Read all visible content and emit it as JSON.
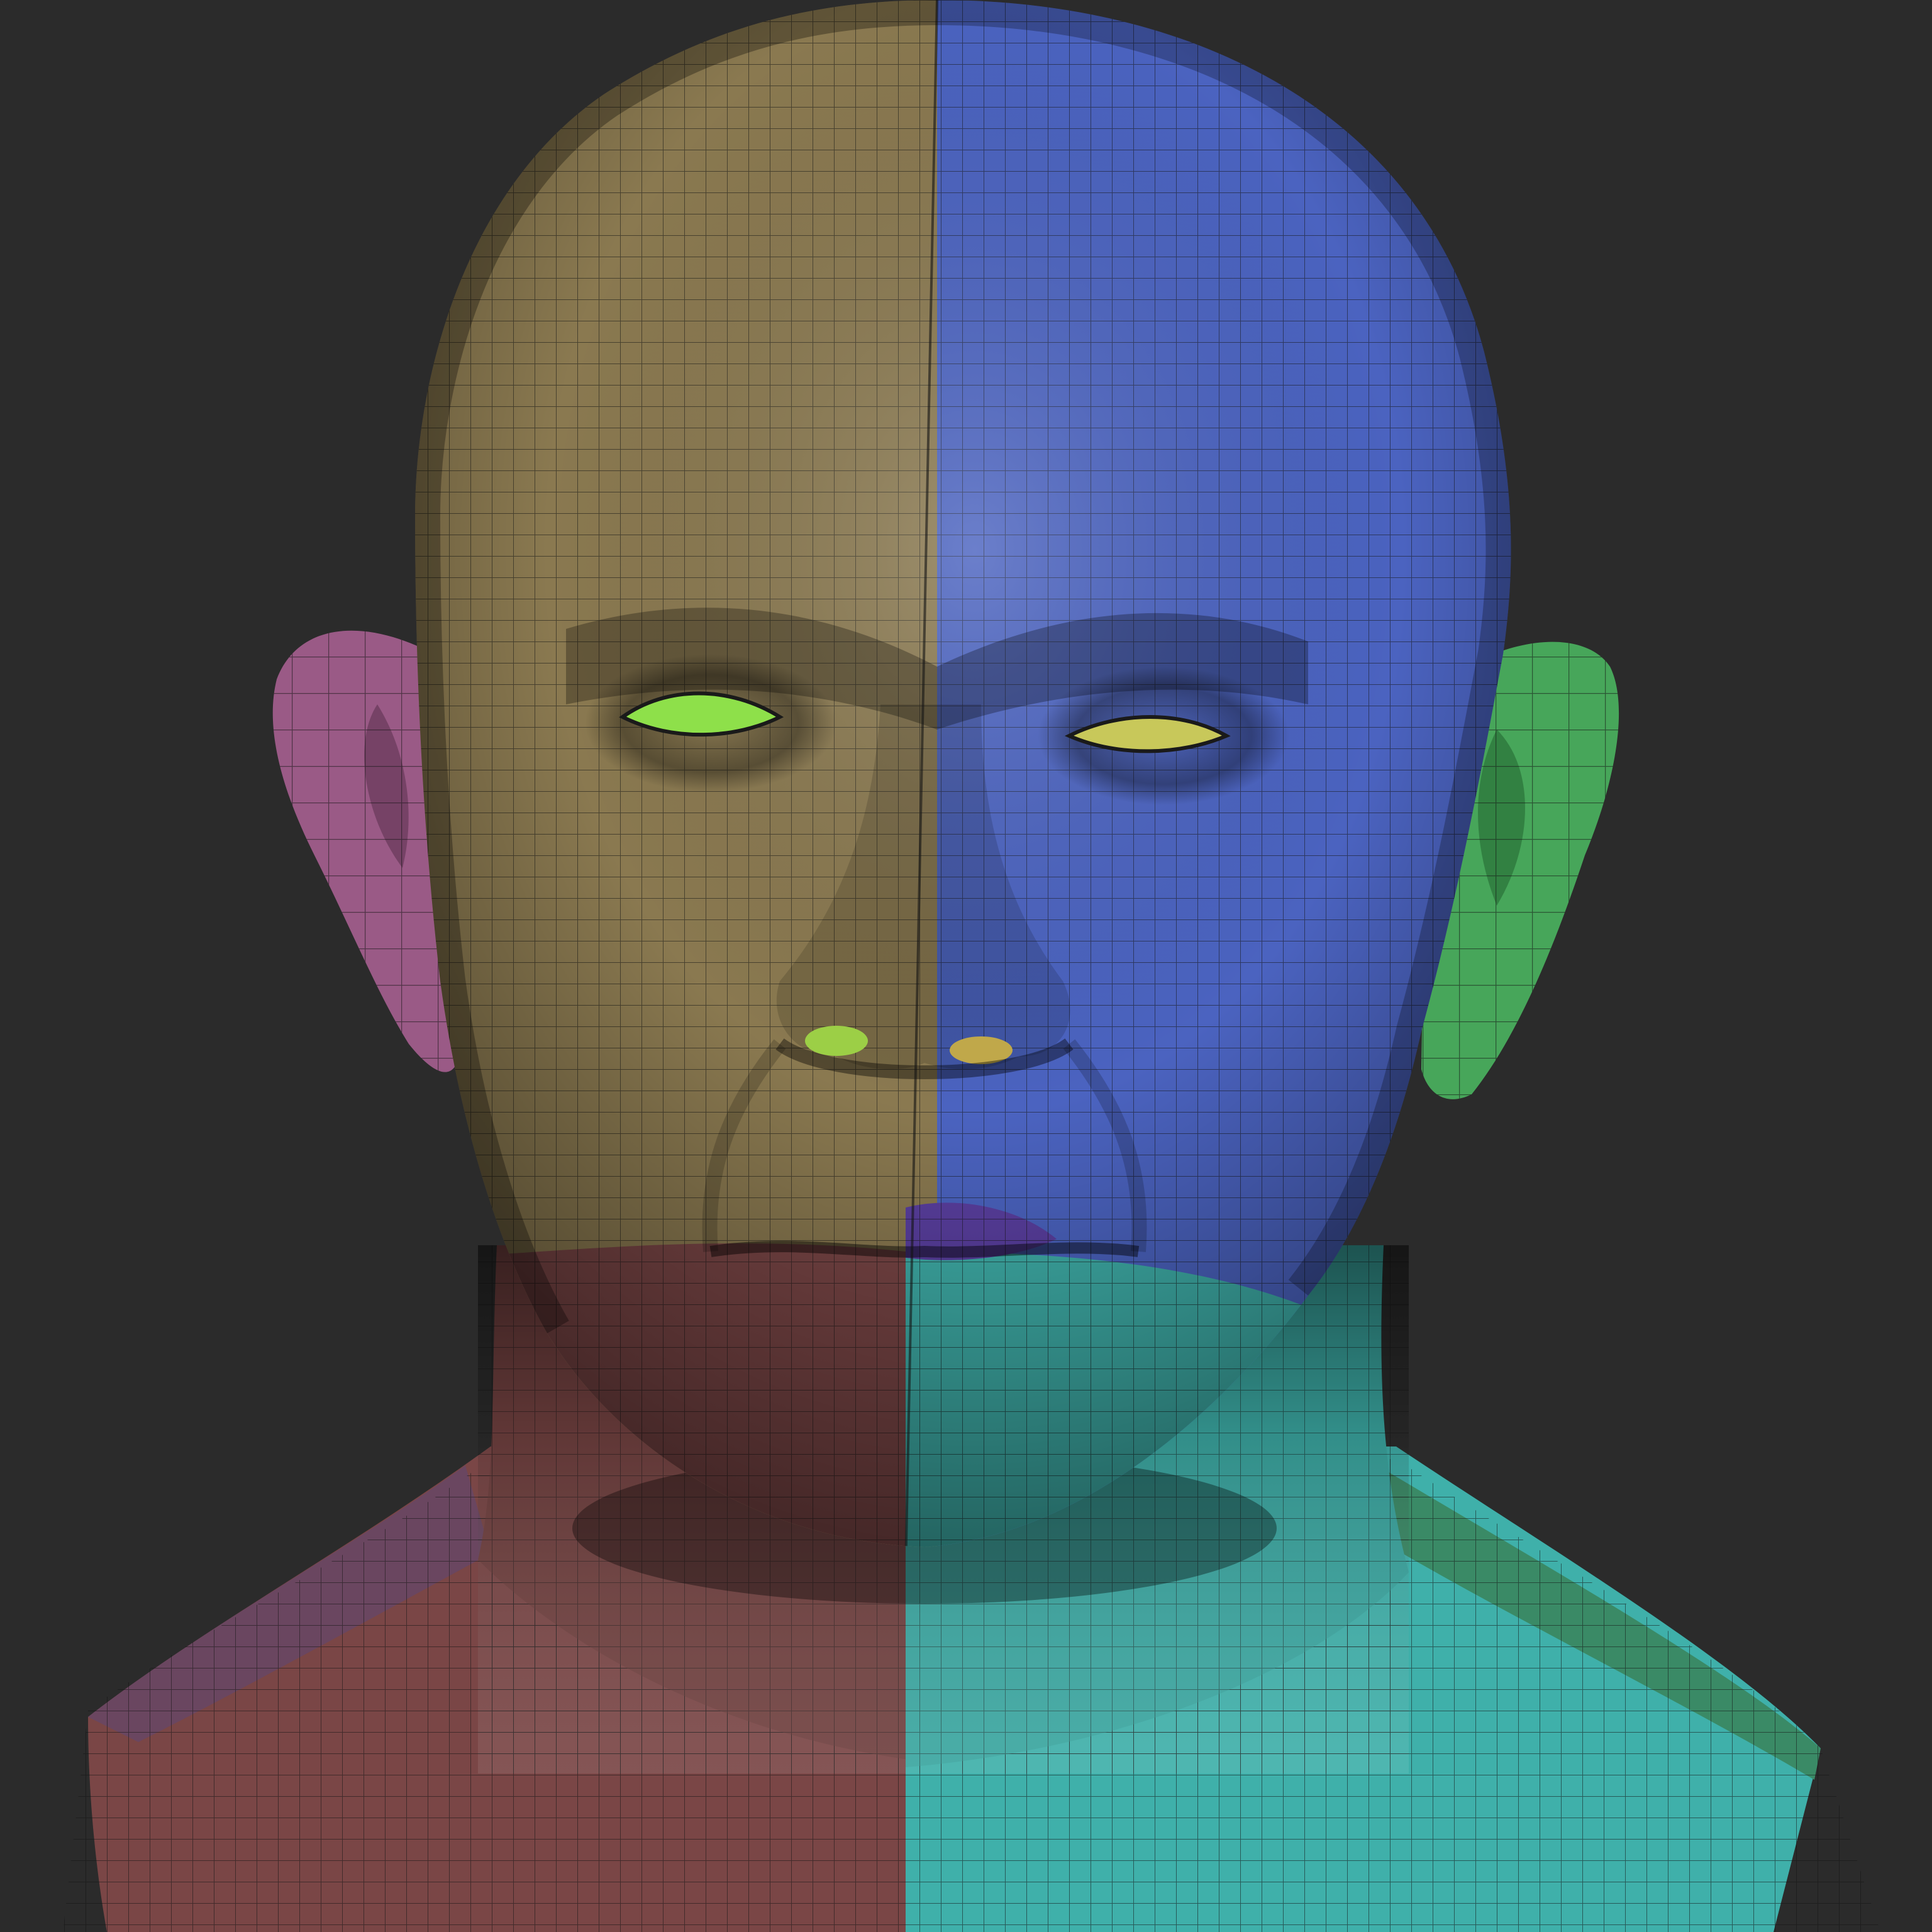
{
  "scene": {
    "subject": "polygroup-head-sculpt",
    "background_color": "#2b2b2b",
    "colors": {
      "cranium_left": "#8a7950",
      "cranium_right": "#4b63c0",
      "ear_left": "#9a5a86",
      "ear_right": "#47a65a",
      "eye_left": "#8ee04a",
      "eye_right": "#c8c85a",
      "lip_purple": "#5a3fa0",
      "neck_left": "#7a4646",
      "neck_right": "#3fb0aa",
      "shoulder_left": "#6a4660",
      "shoulder_right": "#3a8a66",
      "wire": "#1d1d1d"
    },
    "polygroups": [
      "cranium-left",
      "cranium-right",
      "ear-left",
      "ear-right",
      "eye-left",
      "eye-right",
      "lips",
      "neck-left",
      "neck-right",
      "shoulder-left",
      "shoulder-right"
    ]
  }
}
